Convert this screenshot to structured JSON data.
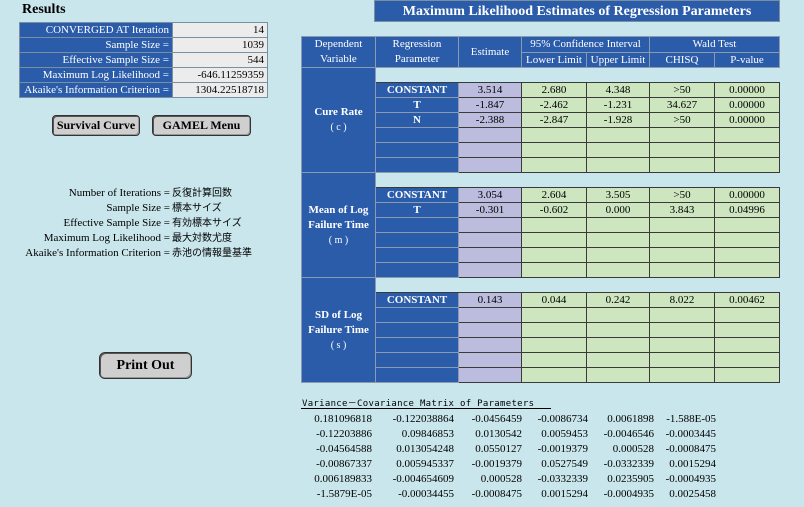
{
  "results": {
    "title": "Results",
    "rows": [
      {
        "label": "CONVERGED AT Iteration",
        "value": "14"
      },
      {
        "label": "Sample Size =",
        "value": "1039"
      },
      {
        "label": "Effective Sample Size =",
        "value": "544"
      },
      {
        "label": "Maximum Log  Likelihood =",
        "value": "-646.11259359"
      },
      {
        "label": "Akaike's Information Criterion =",
        "value": "1304.22518718"
      }
    ]
  },
  "buttons": {
    "survival_curve": "Survival Curve",
    "gamel_menu": "GAMEL  Menu",
    "print_out": "Print Out"
  },
  "glossary": [
    {
      "term": "Number of Iterations =",
      "def": "反復計算回数"
    },
    {
      "term": "Sample Size =",
      "def": "標本サイズ"
    },
    {
      "term": "Effective Sample Size =",
      "def": "有効標本サイズ"
    },
    {
      "term": "Maximum Log  Likelihood =",
      "def": "最大対数尤度"
    },
    {
      "term": "Akaike's Information Criterion =",
      "def": "赤池の情報量基準"
    }
  ],
  "estimates": {
    "title": "Maximum Likelihood Estimates of Regression Parameters",
    "headers": {
      "dependent": "Dependent Variable",
      "parameter": "Regression Parameter",
      "estimate": "Estimate",
      "ci": "95% Confidence Interval",
      "lower": "Lower Limit",
      "upper": "Upper Limit",
      "wald": "Wald Test",
      "chisq": "CHISQ",
      "pvalue": "P-value"
    },
    "groups": [
      {
        "name": "Cure Rate",
        "symbol": "( c )",
        "rows": [
          {
            "param": "CONSTANT",
            "estimate": "3.514",
            "lower": "2.680",
            "upper": "4.348",
            "chisq": ">50",
            "p": "0.00000"
          },
          {
            "param": "T",
            "estimate": "-1.847",
            "lower": "-2.462",
            "upper": "-1.231",
            "chisq": "34.627",
            "p": "0.00000"
          },
          {
            "param": "N",
            "estimate": "-2.388",
            "lower": "-2.847",
            "upper": "-1.928",
            "chisq": ">50",
            "p": "0.00000"
          }
        ]
      },
      {
        "name": "Mean of Log Failure Time",
        "symbol": "( m )",
        "rows": [
          {
            "param": "CONSTANT",
            "estimate": "3.054",
            "lower": "2.604",
            "upper": "3.505",
            "chisq": ">50",
            "p": "0.00000"
          },
          {
            "param": "T",
            "estimate": "-0.301",
            "lower": "-0.602",
            "upper": "0.000",
            "chisq": "3.843",
            "p": "0.04996"
          }
        ]
      },
      {
        "name": "SD of Log Failure Time",
        "symbol": "( s )",
        "rows": [
          {
            "param": "CONSTANT",
            "estimate": "0.143",
            "lower": "0.044",
            "upper": "0.242",
            "chisq": "8.022",
            "p": "0.00462"
          }
        ]
      }
    ]
  },
  "covariance": {
    "title": "Variance－Covariance Matrix of Parameters",
    "rows": [
      [
        "0.181096818",
        "-0.122038864",
        "-0.0456459",
        "-0.0086734",
        "0.0061898",
        "-1.588E-05"
      ],
      [
        "-0.12203886",
        "0.09846853",
        "0.0130542",
        "0.0059453",
        "-0.0046546",
        "-0.0003445"
      ],
      [
        "-0.04564588",
        "0.013054248",
        "0.0550127",
        "-0.0019379",
        "0.000528",
        "-0.0008475"
      ],
      [
        "-0.00867337",
        "0.005945337",
        "-0.0019379",
        "0.0527549",
        "-0.0332339",
        "0.0015294"
      ],
      [
        "0.006189833",
        "-0.004654609",
        "0.000528",
        "-0.0332339",
        "0.0235905",
        "-0.0004935"
      ],
      [
        "-1.5879E-05",
        "-0.00034455",
        "-0.0008475",
        "0.0015294",
        "-0.0004935",
        "0.0025458"
      ]
    ]
  }
}
